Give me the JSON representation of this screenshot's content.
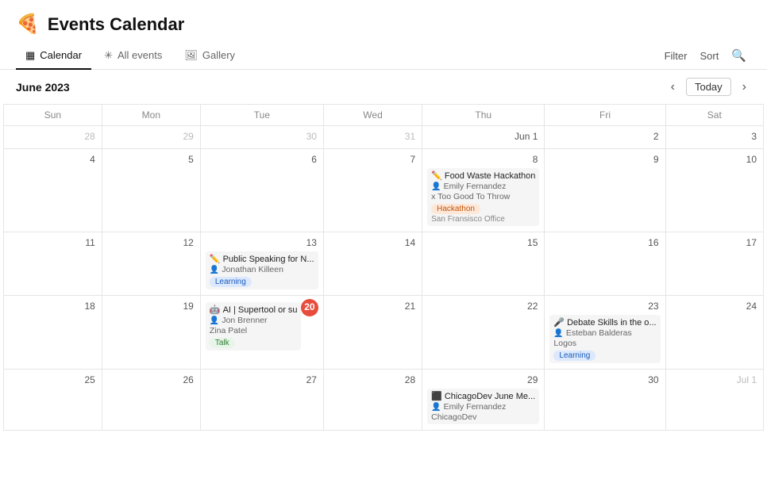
{
  "app": {
    "logo": "🍕",
    "title": "Events Calendar"
  },
  "tabs": [
    {
      "id": "calendar",
      "label": "Calendar",
      "icon": "▦",
      "active": true
    },
    {
      "id": "all-events",
      "label": "All events",
      "icon": "✳",
      "active": false
    },
    {
      "id": "gallery",
      "label": "Gallery",
      "icon": "🖼",
      "active": false
    }
  ],
  "toolbar": {
    "current_month": "June 2023",
    "filter_label": "Filter",
    "sort_label": "Sort",
    "today_label": "Today"
  },
  "calendar": {
    "weekdays": [
      "Sun",
      "Mon",
      "Tue",
      "Wed",
      "Thu",
      "Fri",
      "Sat"
    ],
    "weeks": [
      {
        "days": [
          {
            "num": "28",
            "month": "other"
          },
          {
            "num": "29",
            "month": "other"
          },
          {
            "num": "30",
            "month": "other"
          },
          {
            "num": "31",
            "month": "other"
          },
          {
            "num": "Jun 1",
            "month": "current",
            "events": []
          },
          {
            "num": "2",
            "month": "current"
          },
          {
            "num": "3",
            "month": "current"
          }
        ]
      },
      {
        "days": [
          {
            "num": "4",
            "month": "current"
          },
          {
            "num": "5",
            "month": "current"
          },
          {
            "num": "6",
            "month": "current"
          },
          {
            "num": "7",
            "month": "current"
          },
          {
            "num": "8",
            "month": "current",
            "events": [
              {
                "emoji": "✏️",
                "title": "Food Waste Hackathon",
                "host": "Emily Fernandez",
                "sub": "x Too Good To Throw",
                "tag": "Hackathon",
                "tagClass": "tag-hackathon",
                "location": "San Fransisco Office"
              }
            ]
          },
          {
            "num": "9",
            "month": "current"
          },
          {
            "num": "10",
            "month": "current"
          }
        ]
      },
      {
        "days": [
          {
            "num": "11",
            "month": "current"
          },
          {
            "num": "12",
            "month": "current"
          },
          {
            "num": "13",
            "month": "current",
            "events": [
              {
                "emoji": "✏️",
                "title": "Public Speaking for N...",
                "host": "Jonathan Killeen",
                "tag": "Learning",
                "tagClass": "tag-learning"
              }
            ]
          },
          {
            "num": "14",
            "month": "current"
          },
          {
            "num": "15",
            "month": "current"
          },
          {
            "num": "16",
            "month": "current"
          },
          {
            "num": "17",
            "month": "current"
          }
        ]
      },
      {
        "days": [
          {
            "num": "18",
            "month": "current"
          },
          {
            "num": "19",
            "month": "current"
          },
          {
            "num": "20",
            "month": "current",
            "today": true,
            "events": [
              {
                "emoji": "🤖",
                "title": "AI | Supertool or supe...",
                "host": "Jon Brenner",
                "sub": "Zina Patel",
                "tag": "Talk",
                "tagClass": "tag-talk"
              }
            ]
          },
          {
            "num": "21",
            "month": "current"
          },
          {
            "num": "22",
            "month": "current"
          },
          {
            "num": "23",
            "month": "current",
            "events": [
              {
                "emoji": "🎤",
                "title": "Debate Skills in the o...",
                "host": "Esteban Balderas",
                "sub": "Logos",
                "tag": "Learning",
                "tagClass": "tag-learning"
              }
            ]
          },
          {
            "num": "24",
            "month": "current"
          }
        ]
      },
      {
        "days": [
          {
            "num": "25",
            "month": "current"
          },
          {
            "num": "26",
            "month": "current"
          },
          {
            "num": "27",
            "month": "current"
          },
          {
            "num": "28",
            "month": "current"
          },
          {
            "num": "29",
            "month": "current",
            "events": [
              {
                "emoji": "⬛",
                "title": "ChicagoDev June Me...",
                "host": "Emily Fernandez",
                "sub": "ChicagoDev"
              }
            ]
          },
          {
            "num": "30",
            "month": "current"
          },
          {
            "num": "Jul 1",
            "month": "other"
          }
        ]
      }
    ]
  }
}
